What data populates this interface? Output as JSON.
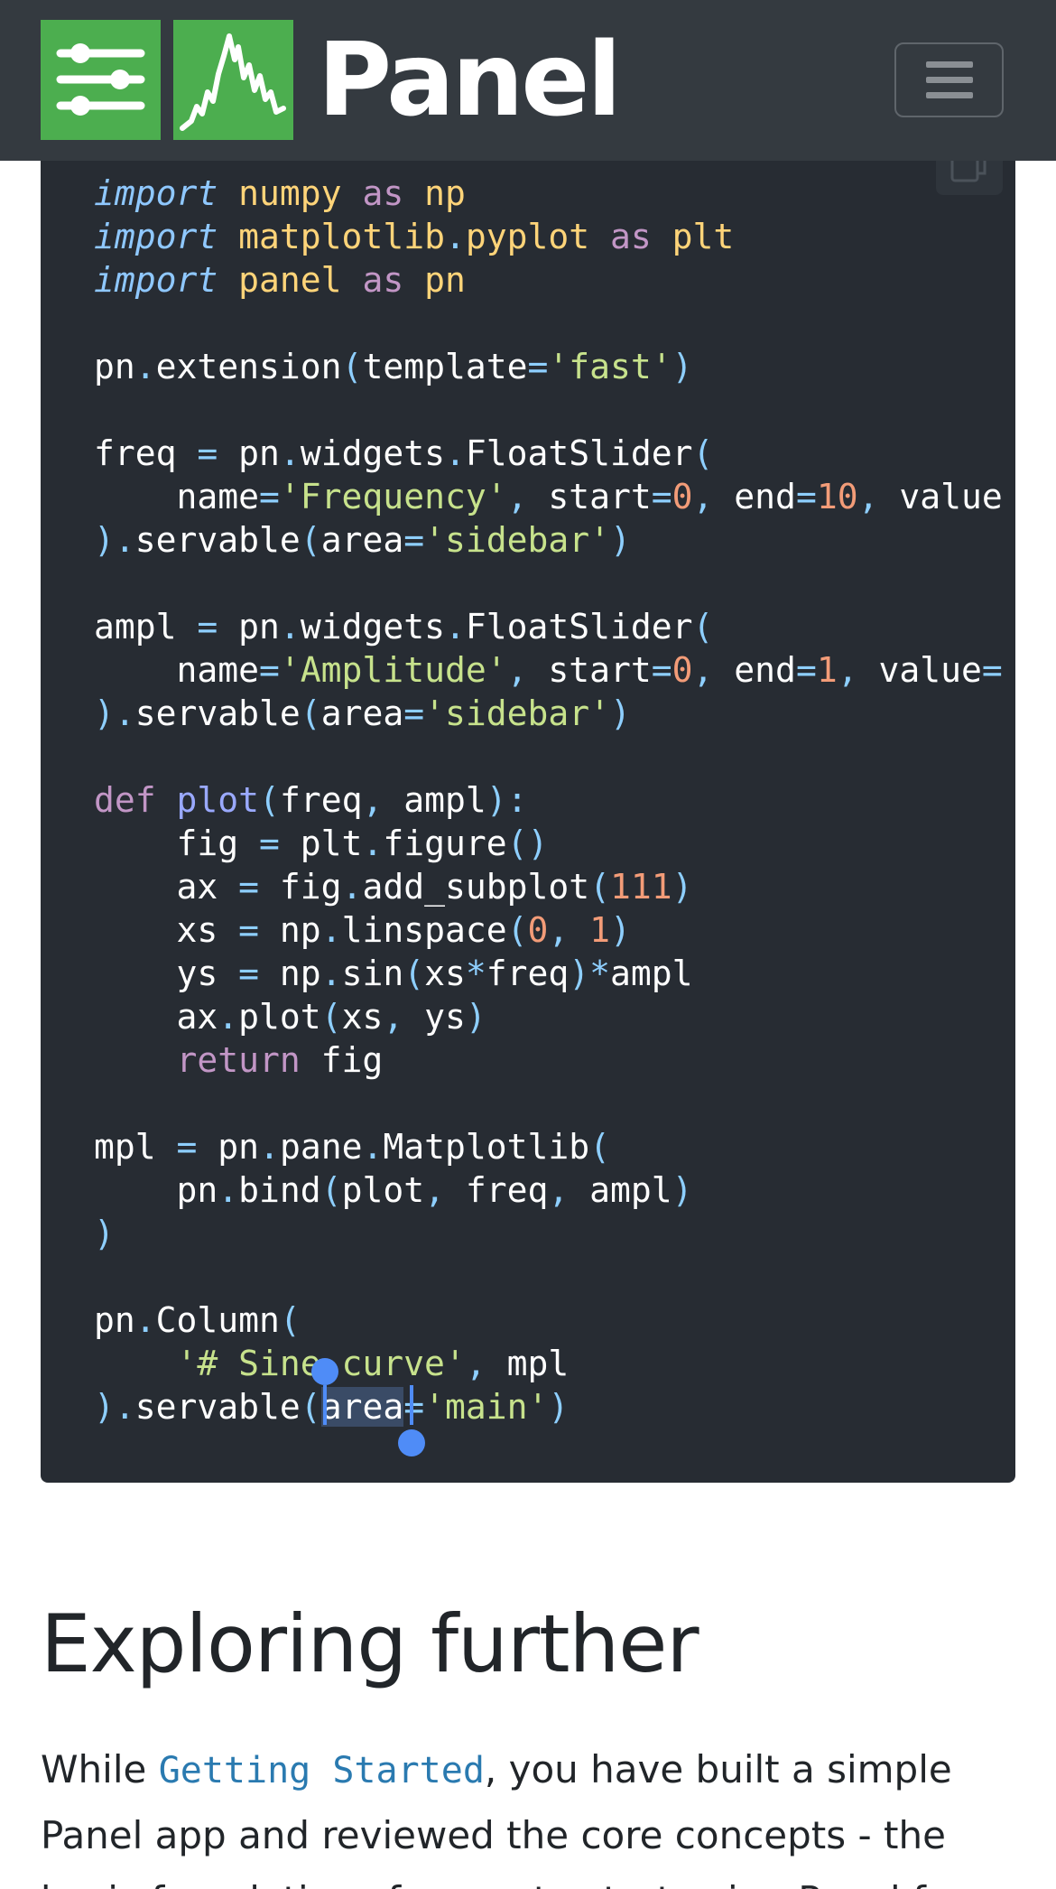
{
  "header": {
    "brand": "Panel",
    "logo_icons": [
      "sliders-icon",
      "sparkline-icon"
    ],
    "menu_icon": "hamburger-icon"
  },
  "code_block": {
    "copy_icon": "copy-icon",
    "selected_text": "area",
    "lines": [
      [
        {
          "t": "import",
          "c": "kw-i"
        },
        {
          "t": " "
        },
        {
          "t": "numpy",
          "c": "mod"
        },
        {
          "t": " "
        },
        {
          "t": "as",
          "c": "kw"
        },
        {
          "t": " "
        },
        {
          "t": "np",
          "c": "mod"
        }
      ],
      [
        {
          "t": "import",
          "c": "kw-i"
        },
        {
          "t": " "
        },
        {
          "t": "matplotlib",
          "c": "mod"
        },
        {
          "t": ".",
          "c": "pn"
        },
        {
          "t": "pyplot",
          "c": "mod"
        },
        {
          "t": " "
        },
        {
          "t": "as",
          "c": "kw"
        },
        {
          "t": " "
        },
        {
          "t": "plt",
          "c": "mod"
        }
      ],
      [
        {
          "t": "import",
          "c": "kw-i"
        },
        {
          "t": " "
        },
        {
          "t": "panel",
          "c": "mod"
        },
        {
          "t": " "
        },
        {
          "t": "as",
          "c": "kw"
        },
        {
          "t": " "
        },
        {
          "t": "pn",
          "c": "mod"
        }
      ],
      [],
      [
        {
          "t": "pn"
        },
        {
          "t": ".",
          "c": "pn"
        },
        {
          "t": "extension"
        },
        {
          "t": "(",
          "c": "pn"
        },
        {
          "t": "template"
        },
        {
          "t": "=",
          "c": "pn"
        },
        {
          "t": "'fast'",
          "c": "str"
        },
        {
          "t": ")",
          "c": "pn"
        }
      ],
      [],
      [
        {
          "t": "freq "
        },
        {
          "t": "=",
          "c": "pn"
        },
        {
          "t": " pn"
        },
        {
          "t": ".",
          "c": "pn"
        },
        {
          "t": "widgets"
        },
        {
          "t": ".",
          "c": "pn"
        },
        {
          "t": "FloatSlider"
        },
        {
          "t": "(",
          "c": "pn"
        }
      ],
      [
        {
          "t": "    name"
        },
        {
          "t": "=",
          "c": "pn"
        },
        {
          "t": "'Frequency'",
          "c": "str"
        },
        {
          "t": ", ",
          "c": "pn"
        },
        {
          "t": "start"
        },
        {
          "t": "=",
          "c": "pn"
        },
        {
          "t": "0",
          "c": "num"
        },
        {
          "t": ", ",
          "c": "pn"
        },
        {
          "t": "end"
        },
        {
          "t": "=",
          "c": "pn"
        },
        {
          "t": "10",
          "c": "num"
        },
        {
          "t": ", ",
          "c": "pn"
        },
        {
          "t": "value"
        }
      ],
      [
        {
          "t": ").",
          "c": "pn"
        },
        {
          "t": "servable"
        },
        {
          "t": "(",
          "c": "pn"
        },
        {
          "t": "area"
        },
        {
          "t": "=",
          "c": "pn"
        },
        {
          "t": "'sidebar'",
          "c": "str"
        },
        {
          "t": ")",
          "c": "pn"
        }
      ],
      [],
      [
        {
          "t": "ampl "
        },
        {
          "t": "=",
          "c": "pn"
        },
        {
          "t": " pn"
        },
        {
          "t": ".",
          "c": "pn"
        },
        {
          "t": "widgets"
        },
        {
          "t": ".",
          "c": "pn"
        },
        {
          "t": "FloatSlider"
        },
        {
          "t": "(",
          "c": "pn"
        }
      ],
      [
        {
          "t": "    name"
        },
        {
          "t": "=",
          "c": "pn"
        },
        {
          "t": "'Amplitude'",
          "c": "str"
        },
        {
          "t": ", ",
          "c": "pn"
        },
        {
          "t": "start"
        },
        {
          "t": "=",
          "c": "pn"
        },
        {
          "t": "0",
          "c": "num"
        },
        {
          "t": ", ",
          "c": "pn"
        },
        {
          "t": "end"
        },
        {
          "t": "=",
          "c": "pn"
        },
        {
          "t": "1",
          "c": "num"
        },
        {
          "t": ", ",
          "c": "pn"
        },
        {
          "t": "value"
        },
        {
          "t": "=",
          "c": "pn"
        }
      ],
      [
        {
          "t": ").",
          "c": "pn"
        },
        {
          "t": "servable"
        },
        {
          "t": "(",
          "c": "pn"
        },
        {
          "t": "area"
        },
        {
          "t": "=",
          "c": "pn"
        },
        {
          "t": "'sidebar'",
          "c": "str"
        },
        {
          "t": ")",
          "c": "pn"
        }
      ],
      [],
      [
        {
          "t": "def",
          "c": "kw"
        },
        {
          "t": " "
        },
        {
          "t": "plot",
          "c": "fn"
        },
        {
          "t": "(",
          "c": "pn"
        },
        {
          "t": "freq"
        },
        {
          "t": ", ",
          "c": "pn"
        },
        {
          "t": "ampl"
        },
        {
          "t": "):",
          "c": "pn"
        }
      ],
      [
        {
          "t": "    fig "
        },
        {
          "t": "=",
          "c": "pn"
        },
        {
          "t": " plt"
        },
        {
          "t": ".",
          "c": "pn"
        },
        {
          "t": "figure"
        },
        {
          "t": "()",
          "c": "pn"
        }
      ],
      [
        {
          "t": "    ax "
        },
        {
          "t": "=",
          "c": "pn"
        },
        {
          "t": " fig"
        },
        {
          "t": ".",
          "c": "pn"
        },
        {
          "t": "add_subplot"
        },
        {
          "t": "(",
          "c": "pn"
        },
        {
          "t": "111",
          "c": "num"
        },
        {
          "t": ")",
          "c": "pn"
        }
      ],
      [
        {
          "t": "    xs "
        },
        {
          "t": "=",
          "c": "pn"
        },
        {
          "t": " np"
        },
        {
          "t": ".",
          "c": "pn"
        },
        {
          "t": "linspace"
        },
        {
          "t": "(",
          "c": "pn"
        },
        {
          "t": "0",
          "c": "num"
        },
        {
          "t": ", ",
          "c": "pn"
        },
        {
          "t": "1",
          "c": "num"
        },
        {
          "t": ")",
          "c": "pn"
        }
      ],
      [
        {
          "t": "    ys "
        },
        {
          "t": "=",
          "c": "pn"
        },
        {
          "t": " np"
        },
        {
          "t": ".",
          "c": "pn"
        },
        {
          "t": "sin"
        },
        {
          "t": "(",
          "c": "pn"
        },
        {
          "t": "xs"
        },
        {
          "t": "*",
          "c": "pn"
        },
        {
          "t": "freq"
        },
        {
          "t": ")*",
          "c": "pn"
        },
        {
          "t": "ampl"
        }
      ],
      [
        {
          "t": "    ax"
        },
        {
          "t": ".",
          "c": "pn"
        },
        {
          "t": "plot"
        },
        {
          "t": "(",
          "c": "pn"
        },
        {
          "t": "xs"
        },
        {
          "t": ", ",
          "c": "pn"
        },
        {
          "t": "ys"
        },
        {
          "t": ")",
          "c": "pn"
        }
      ],
      [
        {
          "t": "    "
        },
        {
          "t": "return",
          "c": "kw"
        },
        {
          "t": " fig"
        }
      ],
      [],
      [
        {
          "t": "mpl "
        },
        {
          "t": "=",
          "c": "pn"
        },
        {
          "t": " pn"
        },
        {
          "t": ".",
          "c": "pn"
        },
        {
          "t": "pane"
        },
        {
          "t": ".",
          "c": "pn"
        },
        {
          "t": "Matplotlib"
        },
        {
          "t": "(",
          "c": "pn"
        }
      ],
      [
        {
          "t": "    pn"
        },
        {
          "t": ".",
          "c": "pn"
        },
        {
          "t": "bind"
        },
        {
          "t": "(",
          "c": "pn"
        },
        {
          "t": "plot"
        },
        {
          "t": ", ",
          "c": "pn"
        },
        {
          "t": "freq"
        },
        {
          "t": ", ",
          "c": "pn"
        },
        {
          "t": "ampl"
        },
        {
          "t": ")",
          "c": "pn"
        }
      ],
      [
        {
          "t": ")",
          "c": "pn"
        }
      ],
      [],
      [
        {
          "t": "pn"
        },
        {
          "t": ".",
          "c": "pn"
        },
        {
          "t": "Column"
        },
        {
          "t": "(",
          "c": "pn"
        }
      ],
      [
        {
          "t": "    "
        },
        {
          "t": "'# Sine curve'",
          "c": "str"
        },
        {
          "t": ", ",
          "c": "pn"
        },
        {
          "t": "mpl"
        }
      ],
      [
        {
          "t": ").",
          "c": "pn"
        },
        {
          "t": "servable"
        },
        {
          "t": "(",
          "c": "pn"
        },
        {
          "t": "area",
          "c": "sel"
        },
        {
          "t": "=",
          "c": "pn"
        },
        {
          "t": "'main'",
          "c": "str"
        },
        {
          "t": ")",
          "c": "pn"
        }
      ]
    ]
  },
  "article": {
    "heading": "Exploring further",
    "para_before": "While ",
    "link_text": "Getting Started",
    "para_after": ", you have built a simple Panel app and reviewed the core concepts - the basic foundations for you to start using Panel f"
  }
}
